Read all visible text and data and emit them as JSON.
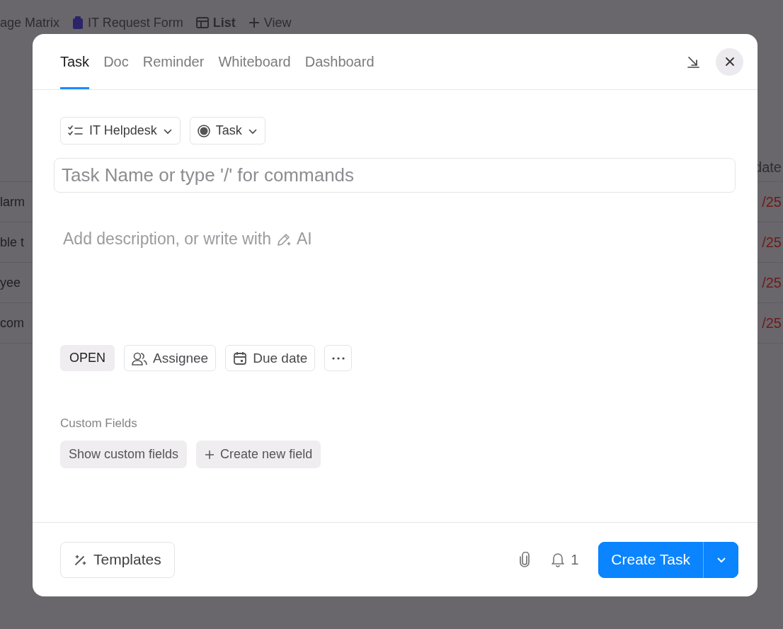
{
  "background": {
    "views": [
      {
        "label": "age Matrix",
        "kind": "text"
      },
      {
        "label": "IT Request Form",
        "kind": "form"
      },
      {
        "label": "List",
        "kind": "list"
      },
      {
        "label": "View",
        "kind": "add"
      }
    ],
    "date_heading": "date",
    "rows": [
      {
        "name": "larm",
        "date": "/25"
      },
      {
        "name": "ble t",
        "date": "/25"
      },
      {
        "name": "yee",
        "date": "/25"
      },
      {
        "name": "com",
        "date": "/25"
      }
    ]
  },
  "modal": {
    "tabs": [
      {
        "label": "Task",
        "selected": true
      },
      {
        "label": "Doc",
        "selected": false
      },
      {
        "label": "Reminder",
        "selected": false
      },
      {
        "label": "Whiteboard",
        "selected": false
      },
      {
        "label": "Dashboard",
        "selected": false
      }
    ],
    "list_picker": "IT Helpdesk",
    "type_picker": "Task",
    "title": {
      "placeholder": "Task Name or type '/' for commands"
    },
    "description": {
      "placeholder": "Add description, or write with",
      "ai": "AI"
    },
    "status": "OPEN",
    "assignee": "Assignee",
    "due_date": "Due date",
    "custom_fields": {
      "label": "Custom Fields",
      "show": "Show custom fields",
      "create": "Create new field"
    },
    "footer": {
      "templates": "Templates",
      "notifications": "1",
      "create": "Create Task"
    }
  }
}
